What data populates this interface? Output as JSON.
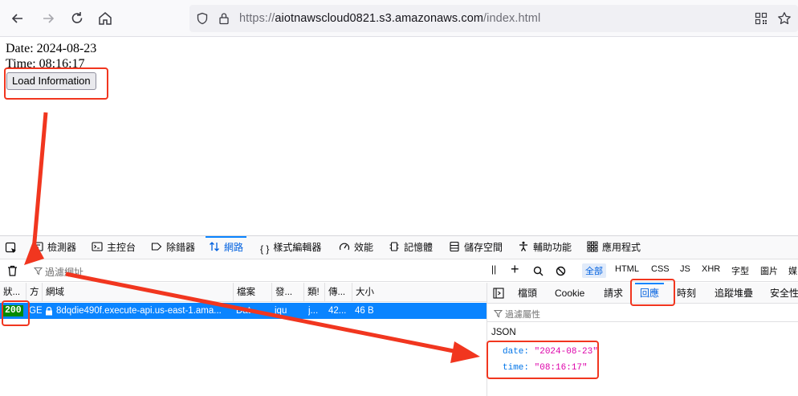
{
  "browser": {
    "url_scheme": "https://",
    "url_host": "aiotnawscloud0821.s3.amazonaws.com",
    "url_path": "/index.html"
  },
  "page": {
    "date_line": "Date: 2024-08-23",
    "time_line": "Time: 08:16:17",
    "load_button": "Load Information"
  },
  "devtools": {
    "tabs": [
      {
        "label": "檢測器",
        "icon": "inspector-icon"
      },
      {
        "label": "主控台",
        "icon": "console-icon"
      },
      {
        "label": "除錯器",
        "icon": "debugger-icon"
      },
      {
        "label": "網路",
        "icon": "network-icon"
      },
      {
        "label": "樣式編輯器",
        "icon": "style-editor-icon"
      },
      {
        "label": "效能",
        "icon": "performance-icon"
      },
      {
        "label": "記憶體",
        "icon": "memory-icon"
      },
      {
        "label": "儲存空間",
        "icon": "storage-icon"
      },
      {
        "label": "輔助功能",
        "icon": "accessibility-icon"
      },
      {
        "label": "應用程式",
        "icon": "application-icon"
      }
    ],
    "filter_placeholder": "過濾網址",
    "type_filters": [
      "全部",
      "HTML",
      "CSS",
      "JS",
      "XHR",
      "字型",
      "圖片",
      "媒"
    ],
    "columns": [
      "狀...",
      "方",
      "網域",
      "檔案",
      "發...",
      "類!",
      "傳...",
      "大小"
    ],
    "request": {
      "status": "200",
      "method": "GE",
      "domain": "8dqdie490f.execute-api.us-east-1.ama...",
      "file": "Dat",
      "initiator": "jqu",
      "type": "j...",
      "transferred": "42...",
      "size": "46 B"
    },
    "side_tabs": [
      "檔頭",
      "Cookie",
      "請求",
      "回應",
      "時刻",
      "追蹤堆疊",
      "安全性"
    ],
    "side_filter_placeholder": "過濾屬性",
    "json_label": "JSON",
    "response": [
      {
        "key": "date:",
        "value": "\"2024-08-23\""
      },
      {
        "key": "time:",
        "value": "\"08:16:17\""
      }
    ]
  },
  "colors": {
    "accent": "#0a84ff",
    "status_ok": "#058b00",
    "annotation": "#f1361f"
  }
}
